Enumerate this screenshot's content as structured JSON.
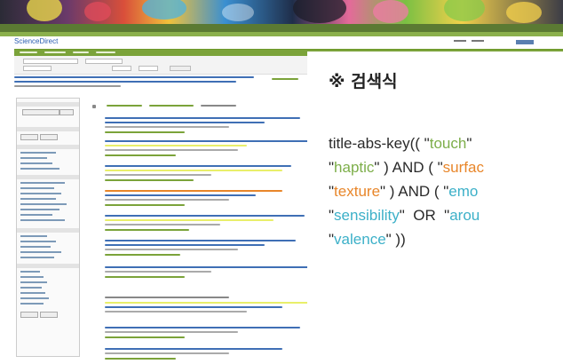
{
  "screenshot": {
    "site_logo": "ScienceDirect",
    "colors": {
      "brand_green": "#6d9a2b",
      "link_blue": "#2a5db0",
      "highlight_yellow": "#e9ef6a"
    }
  },
  "note": {
    "title": "※ 검색식",
    "query_lines": [
      [
        {
          "t": "title-abs-key(( \"",
          "c": "plain"
        },
        {
          "t": "touch",
          "c": "green"
        },
        {
          "t": "\"",
          "c": "plain"
        }
      ],
      [
        {
          "t": "\"",
          "c": "plain"
        },
        {
          "t": "haptic",
          "c": "green"
        },
        {
          "t": "\" ) AND ( \"",
          "c": "plain"
        },
        {
          "t": "surfac",
          "c": "orange"
        }
      ],
      [
        {
          "t": "\"",
          "c": "plain"
        },
        {
          "t": "texture",
          "c": "orange"
        },
        {
          "t": "\" ) AND ( \"",
          "c": "plain"
        },
        {
          "t": "emo",
          "c": "blue"
        }
      ],
      [
        {
          "t": "\"",
          "c": "plain"
        },
        {
          "t": "sensibility",
          "c": "blue"
        },
        {
          "t": "\"  OR  \"",
          "c": "plain"
        },
        {
          "t": "arou",
          "c": "blue"
        }
      ],
      [
        {
          "t": "\"",
          "c": "plain"
        },
        {
          "t": "valence",
          "c": "blue"
        },
        {
          "t": "\" ))",
          "c": "plain"
        }
      ]
    ]
  }
}
